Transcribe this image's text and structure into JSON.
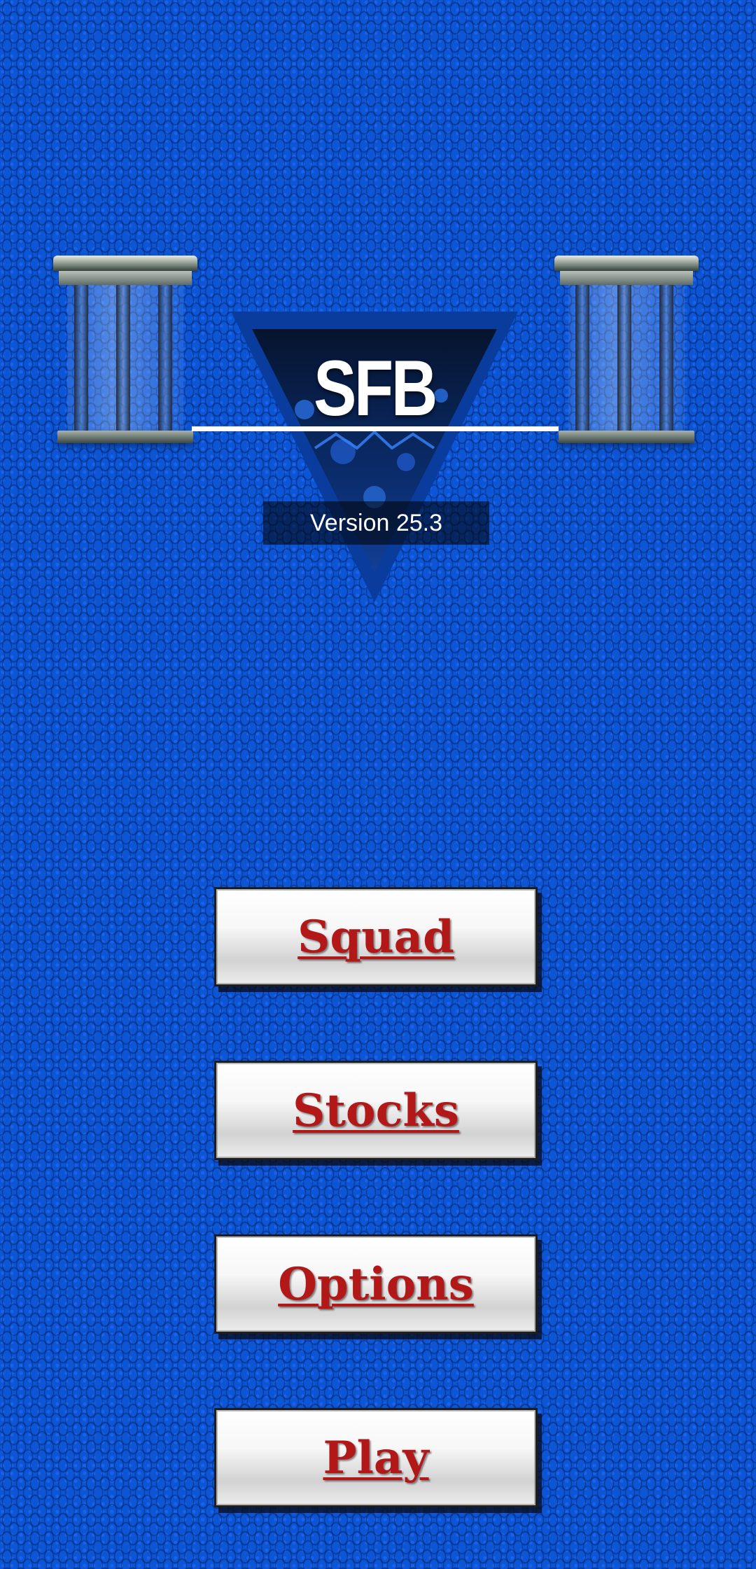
{
  "logo": {
    "text": "SFB",
    "version": "Version 25.3"
  },
  "menu": {
    "buttons": [
      {
        "label": "Squad"
      },
      {
        "label": "Stocks"
      },
      {
        "label": "Options"
      },
      {
        "label": "Play"
      }
    ]
  },
  "colors": {
    "background": "#0c56d6",
    "button_text": "#b31818",
    "logo_triangle": "#0a2a66"
  },
  "icons": [
    "pillar-left-icon",
    "pillar-right-icon"
  ]
}
